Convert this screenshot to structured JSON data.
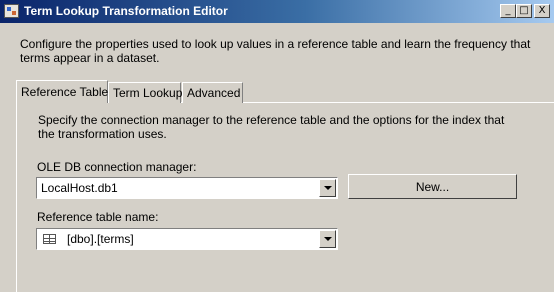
{
  "window": {
    "title": "Term Lookup Transformation Editor",
    "minimize_glyph": "_",
    "maximize_glyph": "□",
    "close_glyph": "X"
  },
  "description": "Configure the properties used to look up values in a reference table and learn the frequency that terms appear in a dataset.",
  "tabs": [
    {
      "label": "Reference Table",
      "active": true
    },
    {
      "label": "Term Lookup",
      "active": false
    },
    {
      "label": "Advanced",
      "active": false
    }
  ],
  "panel": {
    "description": "Specify the connection manager to the reference table and the options for the index that the transformation uses.",
    "connection_label": "OLE DB connection manager:",
    "connection_value": "LocalHost.db1",
    "new_button": "New...",
    "reference_label": "Reference table name:",
    "reference_value": "[dbo].[terms]"
  }
}
